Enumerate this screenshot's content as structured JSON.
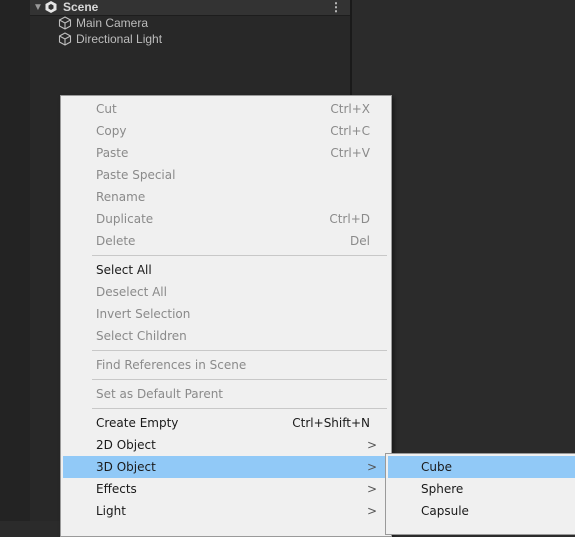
{
  "hierarchy": {
    "scene_label": "Scene",
    "objects": [
      "Main Camera",
      "Directional Light"
    ]
  },
  "context_menu": {
    "groups": [
      [
        {
          "label": "Cut",
          "shortcut": "Ctrl+X",
          "enabled": false
        },
        {
          "label": "Copy",
          "shortcut": "Ctrl+C",
          "enabled": false
        },
        {
          "label": "Paste",
          "shortcut": "Ctrl+V",
          "enabled": false
        },
        {
          "label": "Paste Special",
          "shortcut": "",
          "enabled": false
        },
        {
          "label": "Rename",
          "shortcut": "",
          "enabled": false
        },
        {
          "label": "Duplicate",
          "shortcut": "Ctrl+D",
          "enabled": false
        },
        {
          "label": "Delete",
          "shortcut": "Del",
          "enabled": false
        }
      ],
      [
        {
          "label": "Select All",
          "shortcut": "",
          "enabled": true
        },
        {
          "label": "Deselect All",
          "shortcut": "",
          "enabled": false
        },
        {
          "label": "Invert Selection",
          "shortcut": "",
          "enabled": false
        },
        {
          "label": "Select Children",
          "shortcut": "",
          "enabled": false
        }
      ],
      [
        {
          "label": "Find References in Scene",
          "shortcut": "",
          "enabled": false
        }
      ],
      [
        {
          "label": "Set as Default Parent",
          "shortcut": "",
          "enabled": false
        }
      ],
      [
        {
          "label": "Create Empty",
          "shortcut": "Ctrl+Shift+N",
          "enabled": true
        },
        {
          "label": "2D Object",
          "shortcut": "",
          "enabled": true,
          "submenu": true
        },
        {
          "label": "3D Object",
          "shortcut": "",
          "enabled": true,
          "submenu": true,
          "highlighted": true
        },
        {
          "label": "Effects",
          "shortcut": "",
          "enabled": true,
          "submenu": true
        },
        {
          "label": "Light",
          "shortcut": "",
          "enabled": true,
          "submenu": true
        }
      ]
    ],
    "submenu_arrow": ">"
  },
  "submenu_3d": {
    "items": [
      {
        "label": "Cube",
        "highlighted": true
      },
      {
        "label": "Sphere",
        "highlighted": false
      },
      {
        "label": "Capsule",
        "highlighted": false
      }
    ]
  },
  "colors": {
    "highlight": "#91c9f7",
    "menu_bg": "#f0f0f0",
    "disabled_text": "#8a8a8a",
    "panel_bg": "#282828"
  }
}
